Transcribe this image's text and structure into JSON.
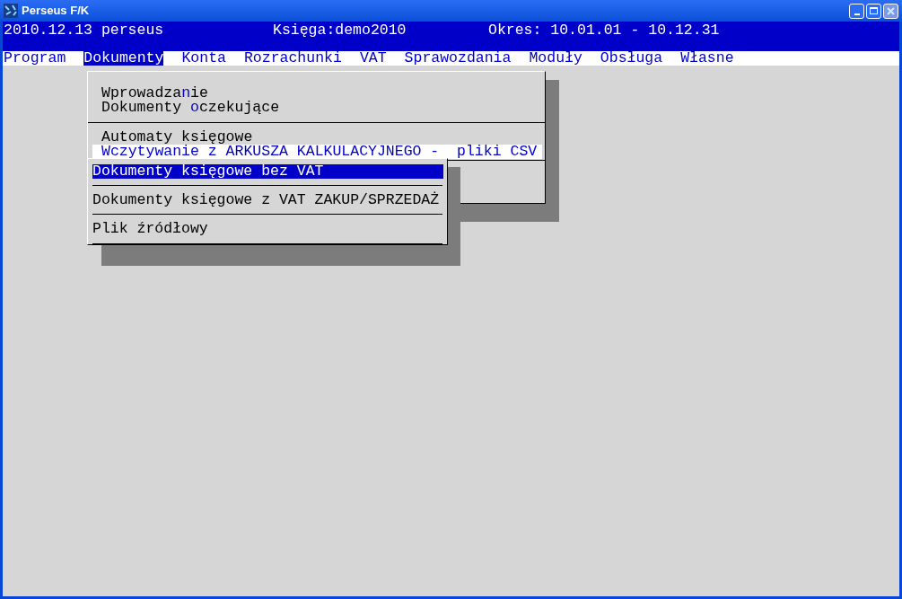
{
  "window": {
    "title": "Perseus F/K"
  },
  "header": {
    "user": "2010.12.13 perseus",
    "book": "Księga:demo2010",
    "period": "Okres: 10.01.01 - 10.12.31"
  },
  "menu_bar": [
    {
      "label": "Program",
      "selected": false
    },
    {
      "label": "Dokumenty",
      "selected": true
    },
    {
      "label": "Konta",
      "selected": false
    },
    {
      "label": "Rozrachunki",
      "selected": false
    },
    {
      "label": "VAT",
      "selected": false
    },
    {
      "label": "Sprawozdania",
      "selected": false
    },
    {
      "label": "Moduły",
      "selected": false
    },
    {
      "label": "Obsługa",
      "selected": false
    },
    {
      "label": "Własne",
      "selected": false
    }
  ],
  "dropdown": {
    "groups": [
      [
        {
          "before": "Wprowadza",
          "hotkey": "n",
          "after": "ie",
          "selected": false
        },
        {
          "before": "Dokumenty ",
          "hotkey": "o",
          "after": "czekujące",
          "selected": false
        }
      ],
      [
        {
          "before": "Automaty księgowe",
          "selected": false
        },
        {
          "before": "Wczytywanie z ARKUSZA KALKULACYJNEGO -  pliki CSV",
          "selected": true
        }
      ]
    ]
  },
  "submenu": {
    "items": [
      {
        "label": "Dokumenty księgowe bez VAT",
        "selected": true
      },
      {
        "label": "Dokumenty księgowe z VAT ZAKUP/SPRZEDAŻ",
        "selected": false
      },
      {
        "label": "Plik źródłowy",
        "selected": false
      }
    ]
  }
}
